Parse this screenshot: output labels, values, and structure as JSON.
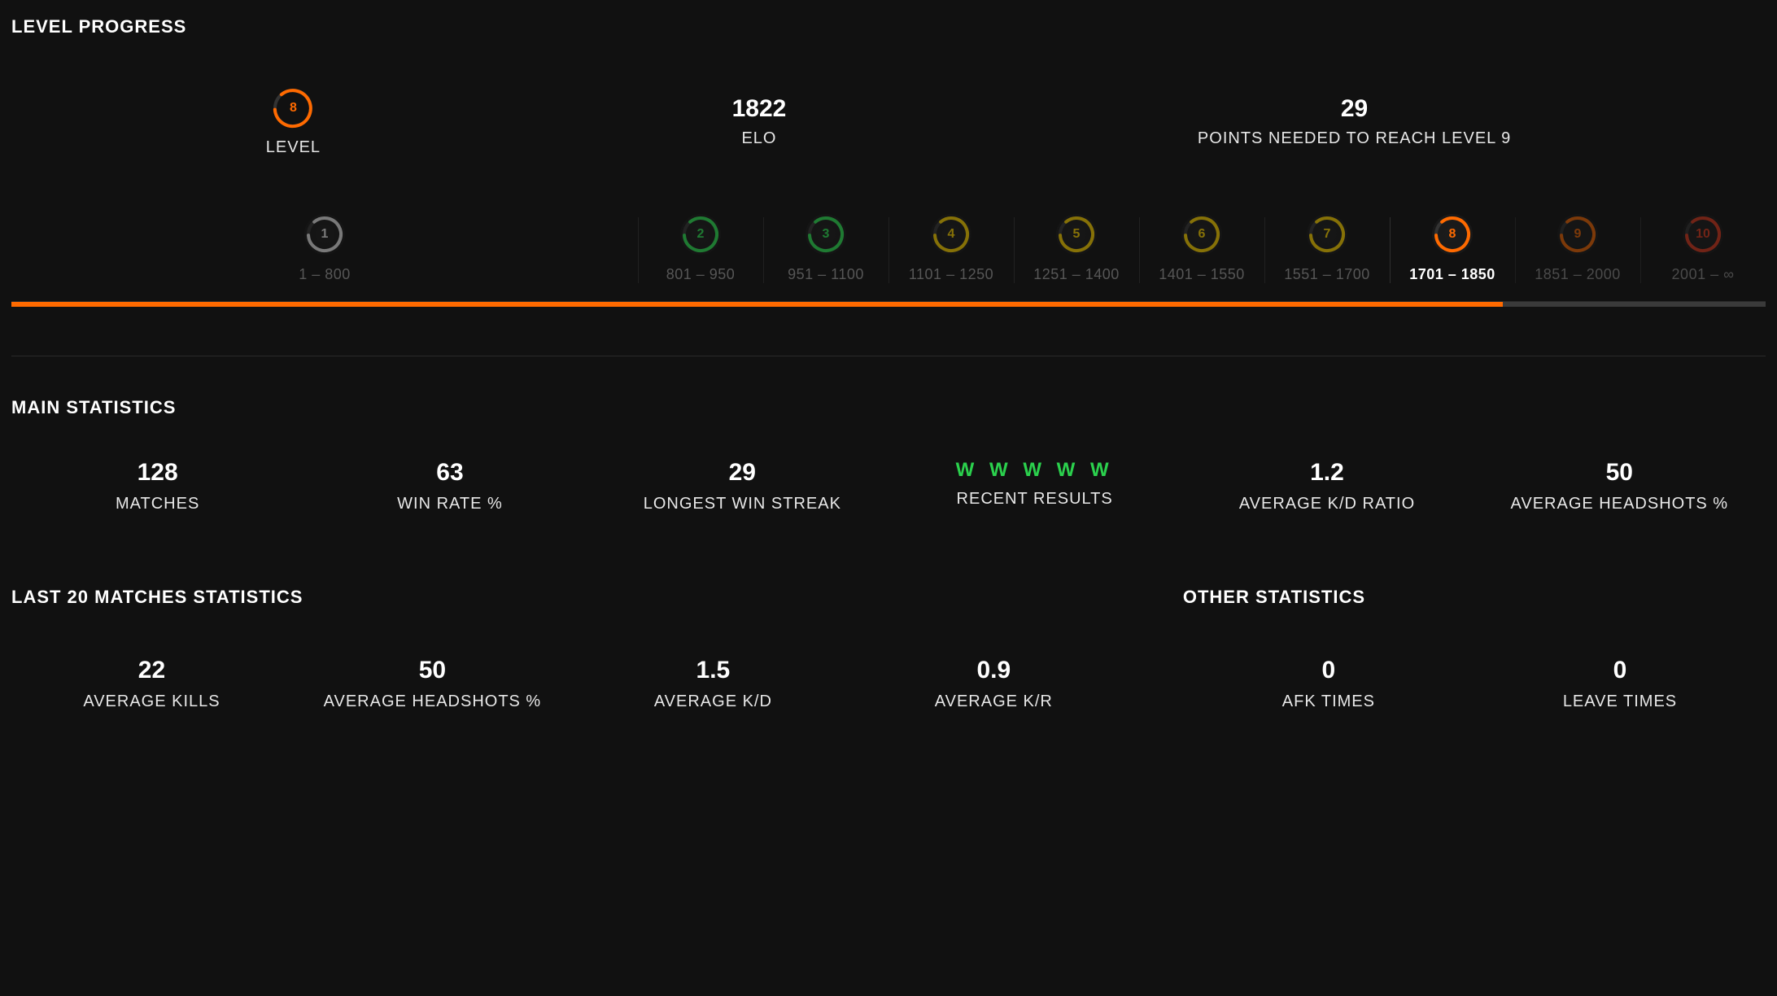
{
  "levelProgress": {
    "title": "LEVEL PROGRESS",
    "levelLabel": "LEVEL",
    "levelNum": "8",
    "elo": {
      "value": "1822",
      "label": "ELO"
    },
    "points": {
      "value": "29",
      "label": "POINTS NEEDED TO REACH LEVEL 9"
    },
    "tiers": [
      {
        "num": "1",
        "range": "1 – 800",
        "colorClass": "c-white"
      },
      {
        "num": "2",
        "range": "801 – 950",
        "colorClass": "c-green"
      },
      {
        "num": "3",
        "range": "951 – 1100",
        "colorClass": "c-green"
      },
      {
        "num": "4",
        "range": "1101 – 1250",
        "colorClass": "c-yellow"
      },
      {
        "num": "5",
        "range": "1251 – 1400",
        "colorClass": "c-yellow"
      },
      {
        "num": "6",
        "range": "1401 – 1550",
        "colorClass": "c-yellow"
      },
      {
        "num": "7",
        "range": "1551 – 1700",
        "colorClass": "c-yellow"
      },
      {
        "num": "8",
        "range": "1701 – 1850",
        "colorClass": "c-orange"
      },
      {
        "num": "9",
        "range": "1851 – 2000",
        "colorClass": "c-orange"
      },
      {
        "num": "10",
        "range": "2001 – ∞",
        "colorClass": "c-red"
      }
    ],
    "activeIndex": 7,
    "progressPercent": 85
  },
  "mainStats": {
    "title": "MAIN STATISTICS",
    "items": [
      {
        "value": "128",
        "label": "MATCHES"
      },
      {
        "value": "63",
        "label": "WIN RATE %"
      },
      {
        "value": "29",
        "label": "LONGEST WIN STREAK"
      },
      {
        "value": "W W W W W",
        "label": "RECENT RESULTS",
        "recent": true
      },
      {
        "value": "1.2",
        "label": "AVERAGE K/D RATIO"
      },
      {
        "value": "50",
        "label": "AVERAGE HEADSHOTS %"
      }
    ]
  },
  "last20": {
    "title": "LAST 20 MATCHES STATISTICS",
    "items": [
      {
        "value": "22",
        "label": "AVERAGE KILLS"
      },
      {
        "value": "50",
        "label": "AVERAGE HEADSHOTS %"
      },
      {
        "value": "1.5",
        "label": "AVERAGE K/D"
      },
      {
        "value": "0.9",
        "label": "AVERAGE K/R"
      }
    ]
  },
  "other": {
    "title": "OTHER STATISTICS",
    "items": [
      {
        "value": "0",
        "label": "AFK TIMES"
      },
      {
        "value": "0",
        "label": "LEAVE TIMES"
      }
    ]
  }
}
